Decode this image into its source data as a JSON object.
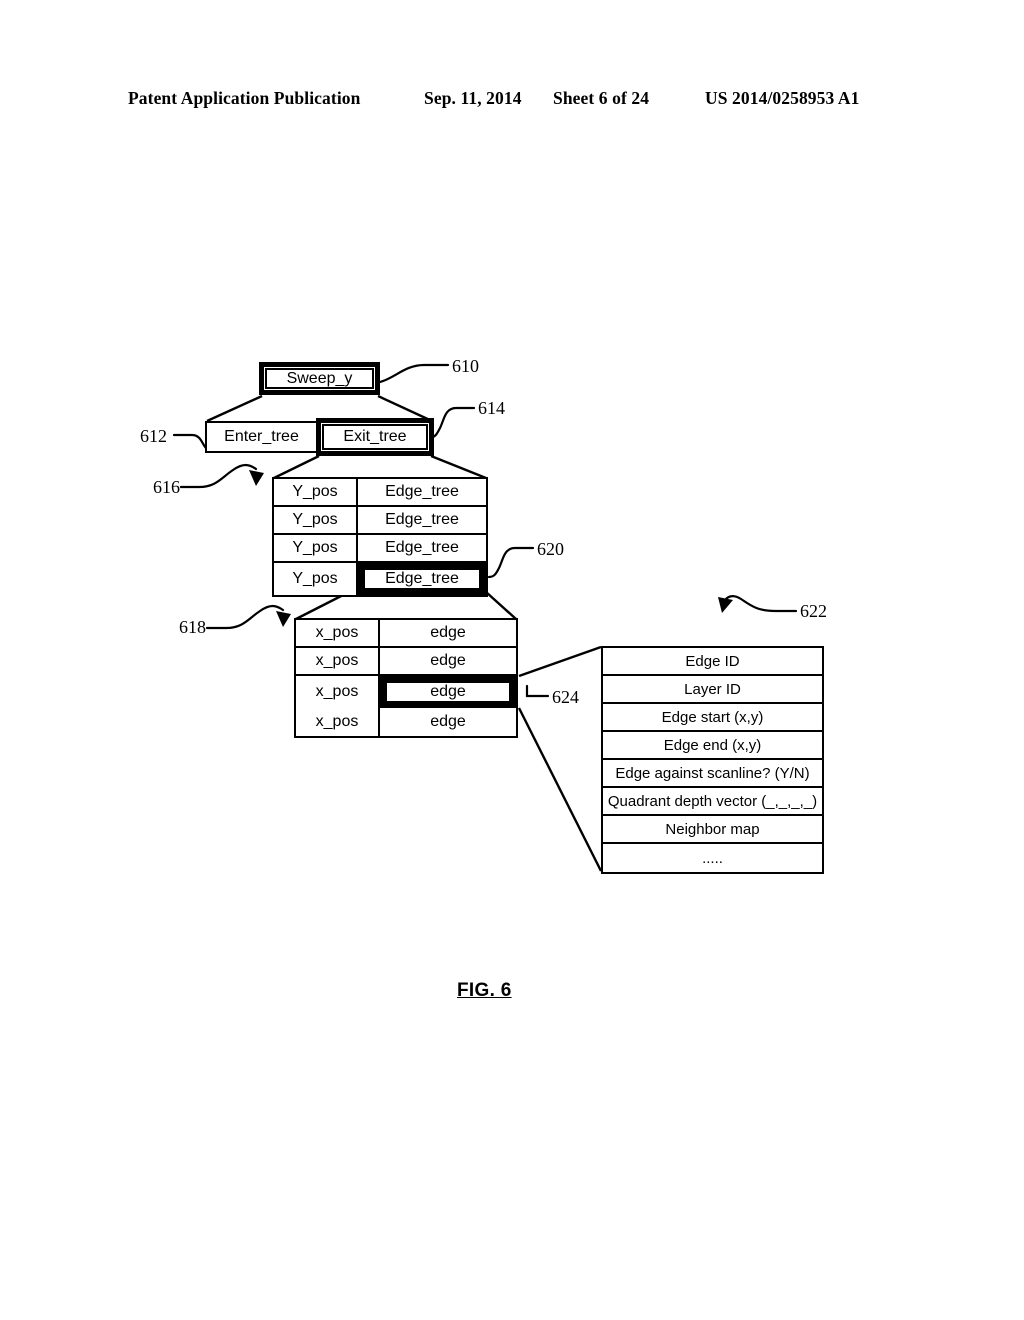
{
  "header": {
    "publication": "Patent Application Publication",
    "date": "Sep. 11, 2014",
    "sheet": "Sheet 6 of 24",
    "patent_number": "US 2014/0258953 A1"
  },
  "figure": {
    "caption": "FIG. 6"
  },
  "nodes": {
    "sweep_y": "Sweep_y",
    "enter_tree": "Enter_tree",
    "exit_tree": "Exit_tree"
  },
  "tables": {
    "y_table": {
      "rows": [
        {
          "key": "Y_pos",
          "value": "Edge_tree"
        },
        {
          "key": "Y_pos",
          "value": "Edge_tree"
        },
        {
          "key": "Y_pos",
          "value": "Edge_tree"
        },
        {
          "key": "Y_pos",
          "value": "Edge_tree"
        }
      ]
    },
    "x_table": {
      "rows": [
        {
          "key": "x_pos",
          "value": "edge"
        },
        {
          "key": "x_pos",
          "value": "edge"
        },
        {
          "key": "x_pos",
          "value": "edge"
        },
        {
          "key": "x_pos",
          "value": "edge"
        }
      ]
    },
    "edge_record": {
      "rows": [
        "Edge ID",
        "Layer ID",
        "Edge start (x,y)",
        "Edge end (x,y)",
        "Edge against scanline? (Y/N)",
        "Quadrant depth vector (_,_,_,_)",
        "Neighbor map",
        "....."
      ]
    }
  },
  "reference_numerals": {
    "n610": "610",
    "n612": "612",
    "n614": "614",
    "n616": "616",
    "n618": "618",
    "n620": "620",
    "n622": "622",
    "n624": "624"
  },
  "colors": {
    "ink": "#000000",
    "paper": "#ffffff"
  }
}
